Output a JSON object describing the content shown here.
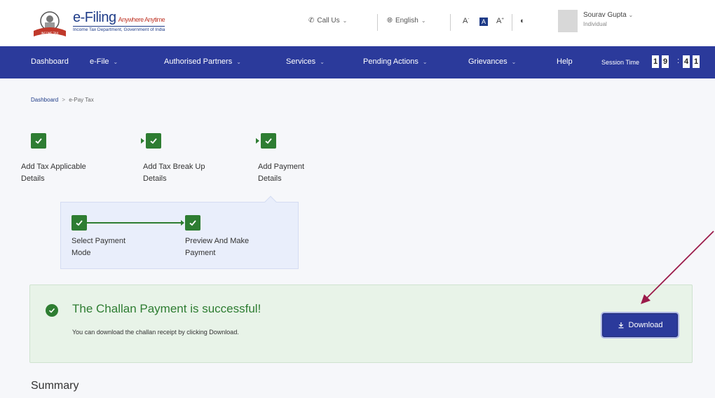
{
  "header": {
    "logo_title": "e-Filing",
    "logo_subtitle": "Anywhere Anytime",
    "logo_tagline": "Income Tax Department, Government of India",
    "call_us": "Call Us",
    "language": "English",
    "font_decrease": "A",
    "font_normal": "A",
    "font_increase": "A",
    "user_name": "Sourav Gupta",
    "user_role": "Individual"
  },
  "nav": {
    "items": [
      {
        "label": "Dashboard",
        "has_menu": false
      },
      {
        "label": "e-File",
        "has_menu": true
      },
      {
        "label": "Authorised Partners",
        "has_menu": true
      },
      {
        "label": "Services",
        "has_menu": true
      },
      {
        "label": "Pending Actions",
        "has_menu": true
      },
      {
        "label": "Grievances",
        "has_menu": true
      },
      {
        "label": "Help",
        "has_menu": false
      }
    ],
    "session_label": "Session Time",
    "session_digits": [
      "1",
      "9",
      "4",
      "1"
    ]
  },
  "breadcrumb": {
    "home": "Dashboard",
    "separator": ">",
    "current": "e-Pay Tax"
  },
  "steps": [
    {
      "line1": "Add Tax Applicable",
      "line2": "Details"
    },
    {
      "line1": "Add Tax Break Up",
      "line2": "Details"
    },
    {
      "line1": "Add Payment",
      "line2": "Details"
    }
  ],
  "sub_steps": [
    {
      "line1": "Select Payment",
      "line2": "Mode"
    },
    {
      "line1": "Preview And Make",
      "line2": "Payment"
    }
  ],
  "success": {
    "title": "The Challan Payment is successful!",
    "message": "You can download the challan receipt by clicking Download.",
    "download_label": "Download"
  },
  "summary_heading": "Summary",
  "colors": {
    "nav_bg": "#2b3a9b",
    "success_green": "#2e7d32",
    "success_bg": "#e8f3e8",
    "annotation_arrow": "#9b1b4a"
  }
}
